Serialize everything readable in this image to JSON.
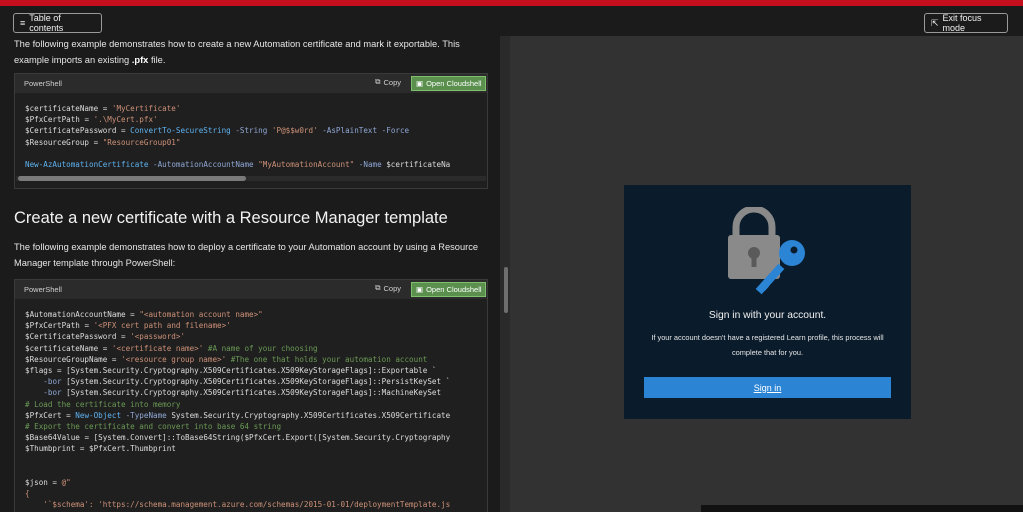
{
  "header": {
    "toc_label": "Table of contents",
    "exit_label": "Exit focus mode"
  },
  "content": {
    "intro_para_1": "The following example demonstrates how to create a new Automation certificate and mark it exportable. This example imports an existing ",
    "intro_para_1_ext": ".pfx",
    "intro_para_1_end": " file.",
    "code1": {
      "lang": "PowerShell",
      "copy_label": "Copy",
      "cloud_label": "Open Cloudshell"
    },
    "heading": "Create a new certificate with a Resource Manager template",
    "para_2": "The following example demonstrates how to deploy a certificate to your Automation account by using a Resource Manager template through PowerShell:",
    "code2": {
      "lang": "PowerShell",
      "copy_label": "Copy",
      "cloud_label": "Open Cloudshell"
    }
  },
  "signin_card": {
    "title": "Sign in with your account.",
    "text": "If your account doesn't have a registered Learn profile, this process will complete that for you.",
    "button": "Sign in"
  },
  "colors": {
    "accent_red": "#c50f1f",
    "cloudshell_green": "#5a8f4e",
    "signin_blue": "#2b84d4",
    "key_blue": "#2b84d4"
  }
}
